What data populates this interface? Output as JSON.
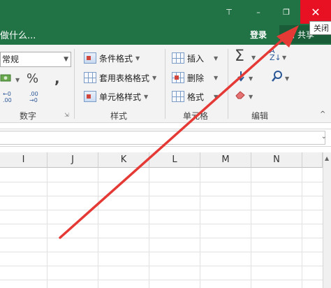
{
  "titlebar": {
    "pin_icon": "⊤",
    "min_icon": "–",
    "max_icon": "❐",
    "close_icon": "✕"
  },
  "cmdbar": {
    "tellme_text": "做什么...",
    "login": "登录",
    "share": "共享"
  },
  "tooltip": "关闭",
  "ribbon": {
    "number": {
      "format_value": "常规",
      "group_label": "数字"
    },
    "styles": {
      "conditional_format": "条件格式",
      "table_format": "套用表格格式",
      "cell_styles": "单元格样式",
      "group_label": "样式"
    },
    "cells": {
      "insert": "插入",
      "delete": "删除",
      "format": "格式",
      "group_label": "单元格"
    },
    "editing": {
      "group_label": "编辑"
    }
  },
  "columns": [
    "I",
    "J",
    "K",
    "L",
    "M",
    "N"
  ],
  "colors": {
    "excel_green": "#217346",
    "close_red": "#e81123",
    "arrow_red": "#e53935"
  }
}
